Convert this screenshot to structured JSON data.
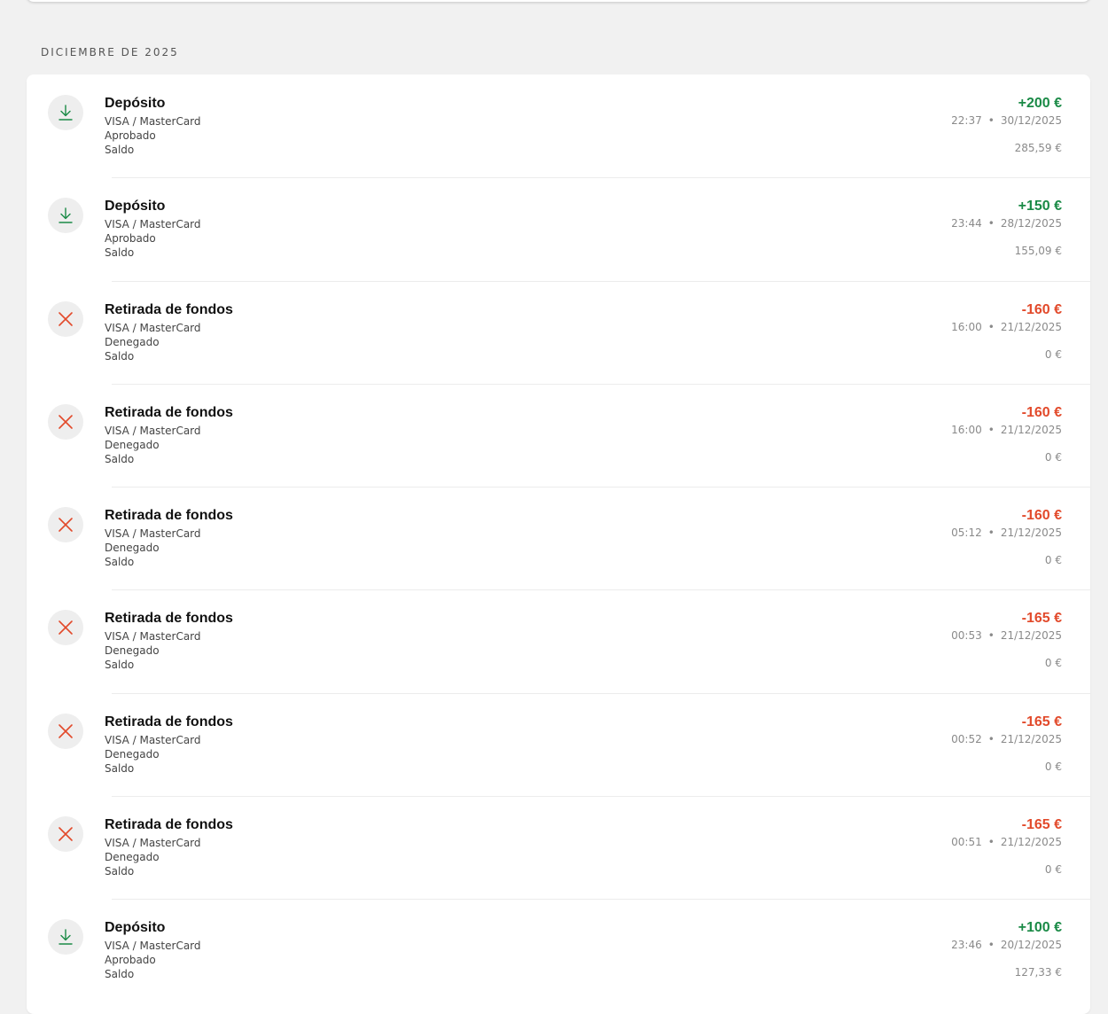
{
  "section": {
    "heading": "DICIEMBRE DE 2025"
  },
  "colors": {
    "positive": "#1a8a46",
    "negative": "#e24a2b",
    "icon_bg": "#eeeeee"
  },
  "transactions": [
    {
      "kind": "deposit",
      "icon": "download-icon",
      "title": "Depósito",
      "method": "VISA / MasterCard",
      "status": "Aprobado",
      "balance_label": "Saldo",
      "amount": "+200 €",
      "time": "22:37",
      "date": "30/12/2025",
      "balance": "285,59 €"
    },
    {
      "kind": "deposit",
      "icon": "download-icon",
      "title": "Depósito",
      "method": "VISA / MasterCard",
      "status": "Aprobado",
      "balance_label": "Saldo",
      "amount": "+150 €",
      "time": "23:44",
      "date": "28/12/2025",
      "balance": "155,09 €"
    },
    {
      "kind": "withdrawal",
      "icon": "close-icon",
      "title": "Retirada de fondos",
      "method": "VISA / MasterCard",
      "status": "Denegado",
      "balance_label": "Saldo",
      "amount": "-160 €",
      "time": "16:00",
      "date": "21/12/2025",
      "balance": "0 €"
    },
    {
      "kind": "withdrawal",
      "icon": "close-icon",
      "title": "Retirada de fondos",
      "method": "VISA / MasterCard",
      "status": "Denegado",
      "balance_label": "Saldo",
      "amount": "-160 €",
      "time": "16:00",
      "date": "21/12/2025",
      "balance": "0 €"
    },
    {
      "kind": "withdrawal",
      "icon": "close-icon",
      "title": "Retirada de fondos",
      "method": "VISA / MasterCard",
      "status": "Denegado",
      "balance_label": "Saldo",
      "amount": "-160 €",
      "time": "05:12",
      "date": "21/12/2025",
      "balance": "0 €"
    },
    {
      "kind": "withdrawal",
      "icon": "close-icon",
      "title": "Retirada de fondos",
      "method": "VISA / MasterCard",
      "status": "Denegado",
      "balance_label": "Saldo",
      "amount": "-165 €",
      "time": "00:53",
      "date": "21/12/2025",
      "balance": "0 €"
    },
    {
      "kind": "withdrawal",
      "icon": "close-icon",
      "title": "Retirada de fondos",
      "method": "VISA / MasterCard",
      "status": "Denegado",
      "balance_label": "Saldo",
      "amount": "-165 €",
      "time": "00:52",
      "date": "21/12/2025",
      "balance": "0 €"
    },
    {
      "kind": "withdrawal",
      "icon": "close-icon",
      "title": "Retirada de fondos",
      "method": "VISA / MasterCard",
      "status": "Denegado",
      "balance_label": "Saldo",
      "amount": "-165 €",
      "time": "00:51",
      "date": "21/12/2025",
      "balance": "0 €"
    },
    {
      "kind": "deposit",
      "icon": "download-icon",
      "title": "Depósito",
      "method": "VISA / MasterCard",
      "status": "Aprobado",
      "balance_label": "Saldo",
      "amount": "+100 €",
      "time": "23:46",
      "date": "20/12/2025",
      "balance": "127,33 €"
    }
  ]
}
